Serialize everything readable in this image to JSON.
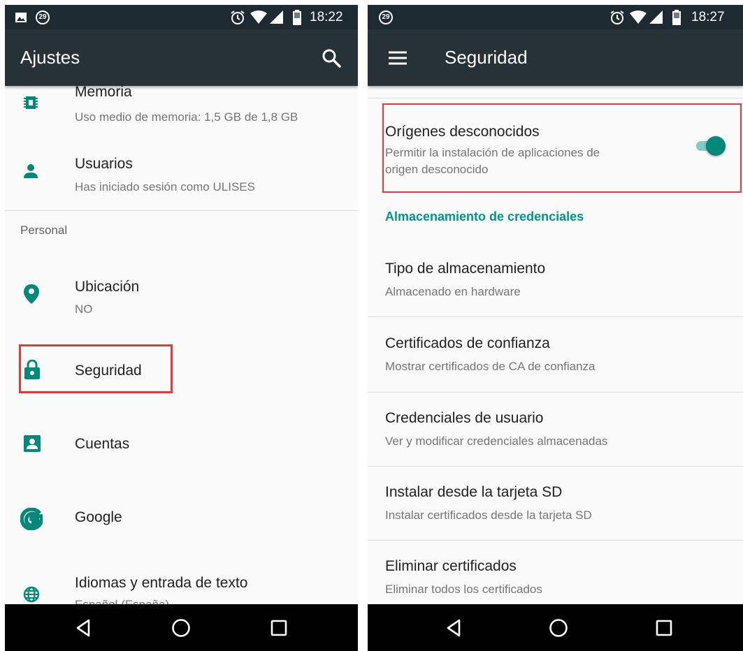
{
  "left": {
    "status_bar": {
      "time": "18:22",
      "notification_badge": "29"
    },
    "app_bar": {
      "title": "Ajustes",
      "search_icon": "search-icon"
    },
    "items": {
      "memoria": {
        "title": "Memoria",
        "subtitle": "Uso medio de memoria: 1,5 GB de 1,8 GB",
        "icon": "memory-icon"
      },
      "usuarios": {
        "title": "Usuarios",
        "subtitle": "Has iniciado sesión como ULISES",
        "icon": "person-icon"
      },
      "category_personal": "Personal",
      "ubicacion": {
        "title": "Ubicación",
        "subtitle": "NO",
        "icon": "location-pin-icon"
      },
      "seguridad": {
        "title": "Seguridad",
        "icon": "lock-icon"
      },
      "cuentas": {
        "title": "Cuentas",
        "icon": "account-box-icon"
      },
      "google": {
        "title": "Google",
        "icon": "google-icon"
      },
      "idiomas": {
        "title": "Idiomas y entrada de texto",
        "subtitle": "Español (España)",
        "icon": "globe-icon"
      }
    }
  },
  "right": {
    "status_bar": {
      "time": "18:27",
      "notification_badge": "29"
    },
    "app_bar": {
      "title": "Seguridad",
      "menu_icon": "menu-icon"
    },
    "origenes": {
      "title": "Orígenes desconocidos",
      "subtitle_line1": "Permitir la instalación de aplicaciones de",
      "subtitle_line2": "origen desconocido",
      "toggle_on": true
    },
    "section_header": "Almacenamiento de credenciales",
    "items": [
      {
        "title": "Tipo de almacenamiento",
        "subtitle": "Almacenado en hardware"
      },
      {
        "title": "Certificados de confianza",
        "subtitle": "Mostrar certificados de CA de confianza"
      },
      {
        "title": "Credenciales de usuario",
        "subtitle": "Ver y modificar credenciales almacenadas"
      },
      {
        "title": "Instalar desde la tarjeta SD",
        "subtitle": "Instalar certificados desde la tarjeta SD"
      },
      {
        "title": "Eliminar certificados",
        "subtitle": "Eliminar todos los certificados"
      }
    ]
  },
  "colors": {
    "accent": "#009688",
    "app_bar": "#263238",
    "status_bar": "#1e2a32",
    "highlight": "#e53935"
  },
  "nav_icons": [
    "back-icon",
    "home-icon",
    "recents-icon"
  ]
}
